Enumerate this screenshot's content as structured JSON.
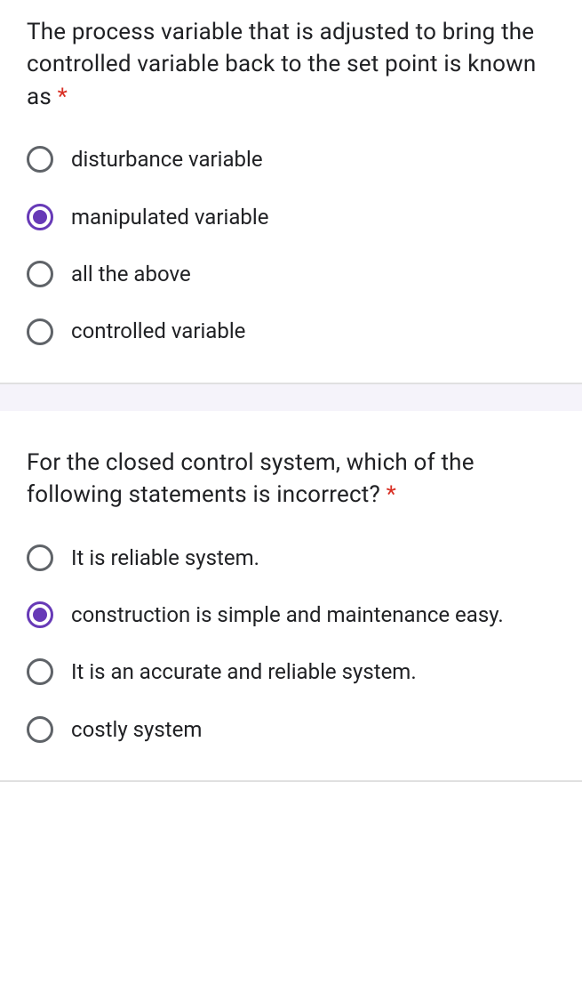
{
  "questions": [
    {
      "text": "The process variable that is adjusted to bring the controlled variable back to the set point is known as ",
      "required": "*",
      "options": [
        {
          "label": "disturbance variable",
          "selected": false
        },
        {
          "label": "manipulated variable",
          "selected": true
        },
        {
          "label": "all the above",
          "selected": false
        },
        {
          "label": "controlled variable",
          "selected": false
        }
      ]
    },
    {
      "text": "For the closed control system, which of the following statements is incorrect? ",
      "required": "*",
      "options": [
        {
          "label": "It is reliable system.",
          "selected": false
        },
        {
          "label": "construction is simple and maintenance easy.",
          "selected": true
        },
        {
          "label": "It is an accurate and reliable system.",
          "selected": false
        },
        {
          "label": "costly system",
          "selected": false
        }
      ]
    }
  ]
}
